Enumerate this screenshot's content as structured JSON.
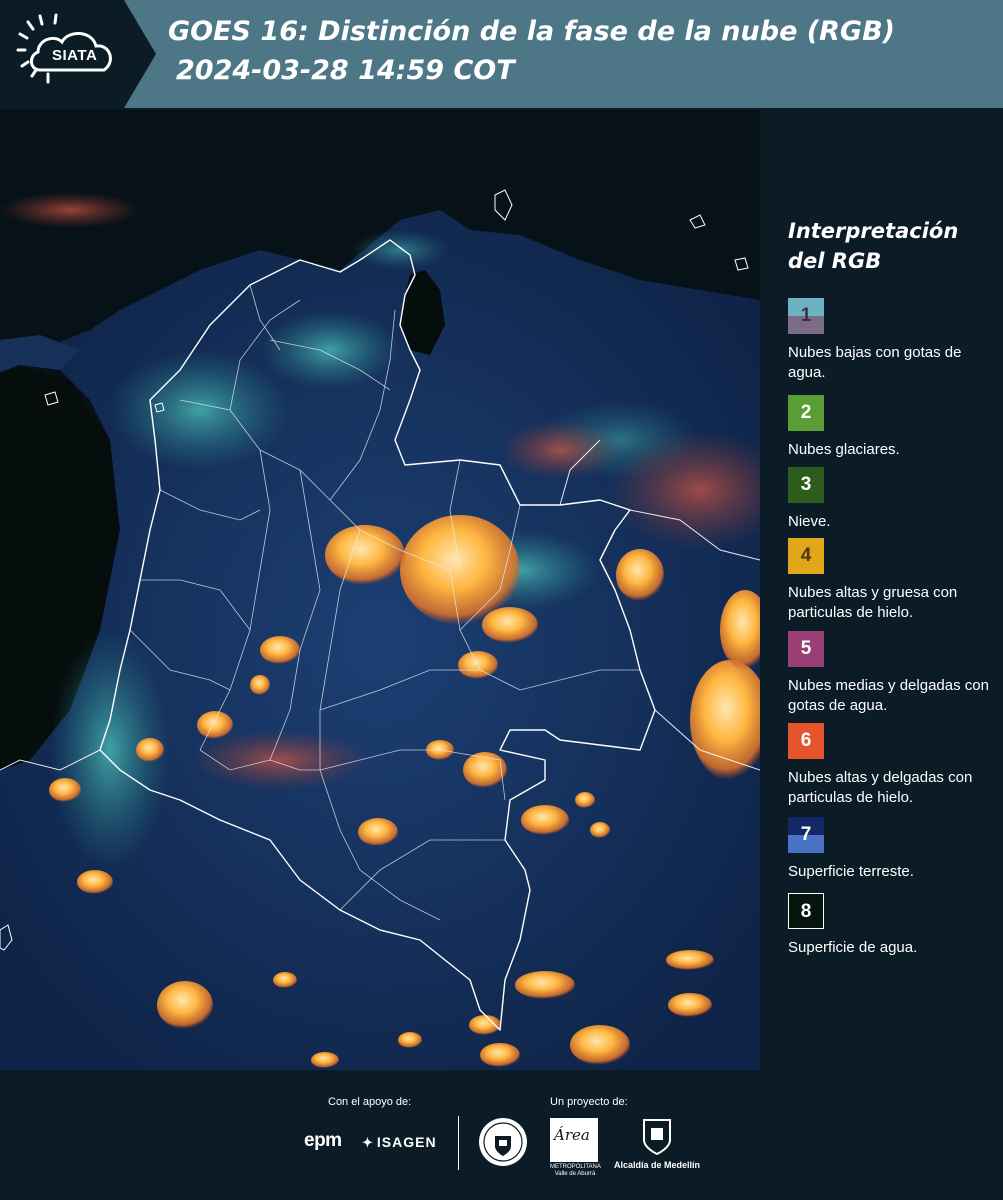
{
  "header": {
    "logo_text": "SIATA",
    "title_line1": "GOES 16: Distinción de la fase de la nube (RGB)",
    "title_line2": "2024-03-28 14:59 COT"
  },
  "legend": {
    "title_line1": "Interpretación",
    "title_line2": "del RGB",
    "items": [
      {
        "number": "1",
        "label": "Nubes bajas con gotas de agua.",
        "color_top": "#6cb2c0",
        "color_bottom": "#7c6b85"
      },
      {
        "number": "2",
        "label": "Nubes glaciares.",
        "color": "#5a9d35"
      },
      {
        "number": "3",
        "label": "Nieve.",
        "color": "#2e5c1c"
      },
      {
        "number": "4",
        "label": "Nubes altas y gruesa con particulas de hielo.",
        "color": "#e0a71b"
      },
      {
        "number": "5",
        "label": "Nubes medias y delgadas con gotas de agua.",
        "color": "#9a3f75"
      },
      {
        "number": "6",
        "label": "Nubes altas y delgadas con particulas de hielo.",
        "color": "#e4552c"
      },
      {
        "number": "7",
        "label": "Superficie terreste.",
        "color_top": "#142868",
        "color_bottom": "#4a72c4"
      },
      {
        "number": "8",
        "label": "Superficie de agua.",
        "color": "#06140e"
      }
    ]
  },
  "footer": {
    "support_label": "Con el apoyo de:",
    "project_label": "Un proyecto de:",
    "epm_logo": "epm",
    "isagen_logo": "ISAGEN",
    "area_logo_text": "Área",
    "area_logo_sub1": "METROPOLITANA",
    "area_logo_sub2": "Valle de Aburrá",
    "alcaldia_name": "Alcaldía de Medellín"
  }
}
